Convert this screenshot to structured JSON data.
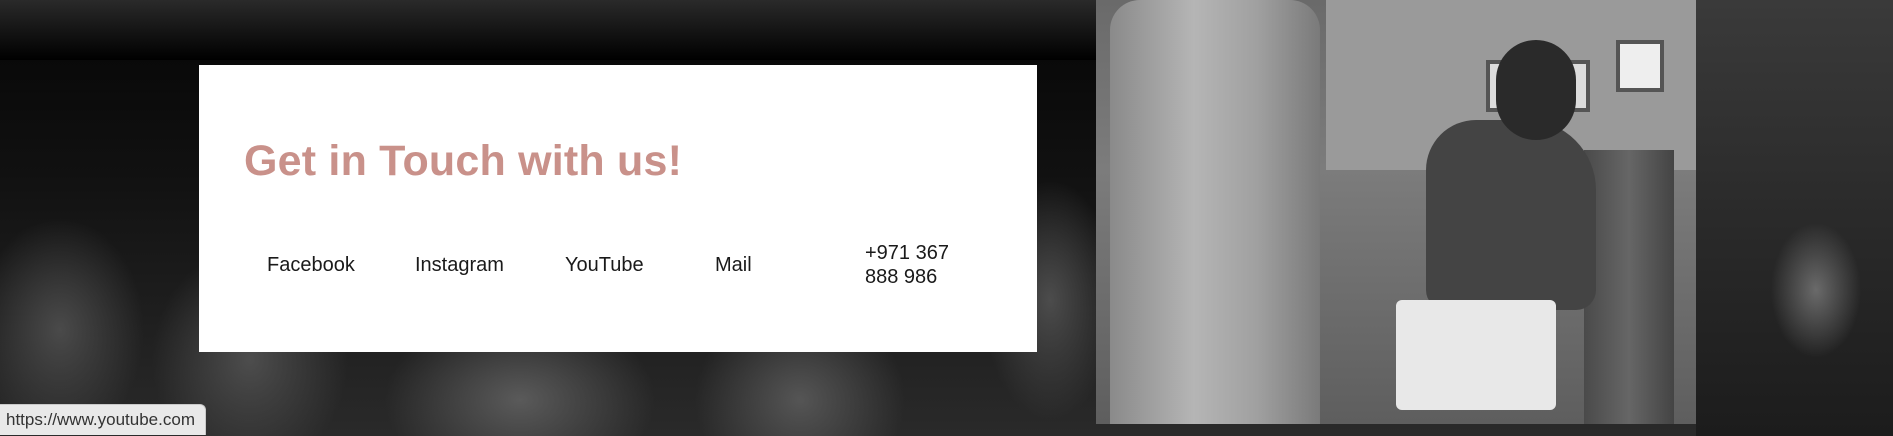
{
  "contact": {
    "title": "Get in Touch with us!",
    "links": {
      "facebook": "Facebook",
      "instagram": "Instagram",
      "youtube": "YouTube",
      "mail": "Mail"
    },
    "phone": {
      "line1": "+971 367",
      "line2": "888 986"
    }
  },
  "status_bar": {
    "url": "https://www.youtube.com"
  },
  "colors": {
    "title": "#c9918a",
    "card_background": "#ffffff",
    "link_text": "#1a1a1a"
  }
}
